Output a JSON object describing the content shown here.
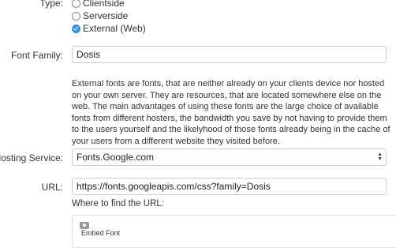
{
  "type_field": {
    "label": "Type:",
    "options": [
      {
        "label": "Clientside",
        "checked": false
      },
      {
        "label": "Serverside",
        "checked": false
      },
      {
        "label": "External (Web)",
        "checked": true
      }
    ]
  },
  "font_family": {
    "label": "Font Family:",
    "value": "Dosis"
  },
  "description": "External fonts are fonts, that are neither already on your clients device nor hosted on your own server. They are resources, that are located somewhere else on the web. The main advantages of using these fonts are the large choice of available fonts from different hosters, the bandwidth you save by not having to provide them to the users yourself and the likelyhood of those fonts already being in the cache of your users from a different website they visited before.",
  "hosting_service": {
    "label": "Hosting Service:",
    "value": "Fonts.Google.com"
  },
  "url": {
    "label": "URL:",
    "value": "https://fonts.googleapis.com/css?family=Dosis"
  },
  "url_hint": "Where to find the URL:",
  "preview": {
    "icon": "camera-icon",
    "caption": "Embed Font"
  },
  "colors": {
    "accent": "#2f8ee6",
    "border": "#cccccc",
    "text": "#333333"
  }
}
